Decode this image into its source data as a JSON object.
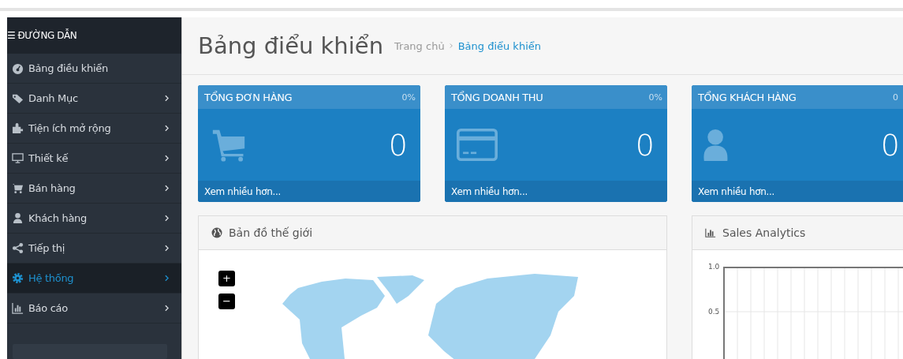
{
  "sidebar": {
    "title": "☰ ĐƯỜNG DẪN",
    "items": [
      {
        "label": "Bảng điều khiển",
        "has_children": false,
        "selected": false
      },
      {
        "label": "Danh Mục",
        "has_children": true,
        "selected": false
      },
      {
        "label": "Tiện ích mở rộng",
        "has_children": true,
        "selected": false
      },
      {
        "label": "Thiết kế",
        "has_children": true,
        "selected": false
      },
      {
        "label": "Bán hàng",
        "has_children": true,
        "selected": false
      },
      {
        "label": "Khách hàng",
        "has_children": true,
        "selected": false
      },
      {
        "label": "Tiếp thị",
        "has_children": true,
        "selected": false
      },
      {
        "label": "Hệ thống",
        "has_children": true,
        "selected": true
      },
      {
        "label": "Báo cáo",
        "has_children": true,
        "selected": false
      }
    ]
  },
  "header": {
    "title": "Bảng điểu khiển",
    "breadcrumb": [
      "Trang chủ",
      "Bảng điểu khiển"
    ]
  },
  "stat_cards": [
    {
      "title": "TỔNG ĐƠN HÀNG",
      "percent": "0%",
      "value": "0",
      "link": "Xem nhiều hơn..."
    },
    {
      "title": "TỔNG DOANH THU",
      "percent": "0%",
      "value": "0",
      "link": "Xem nhiều hơn..."
    },
    {
      "title": "TỔNG KHÁCH HÀNG",
      "percent": "0",
      "value": "0",
      "link": "Xem nhiều hơn..."
    }
  ],
  "map_panel": {
    "title": "Bản đồ thế giới",
    "zoom_in": "+",
    "zoom_out": "−"
  },
  "sales_panel": {
    "title": "Sales Analytics",
    "y_ticks": [
      "1.0",
      "0.5"
    ]
  }
}
